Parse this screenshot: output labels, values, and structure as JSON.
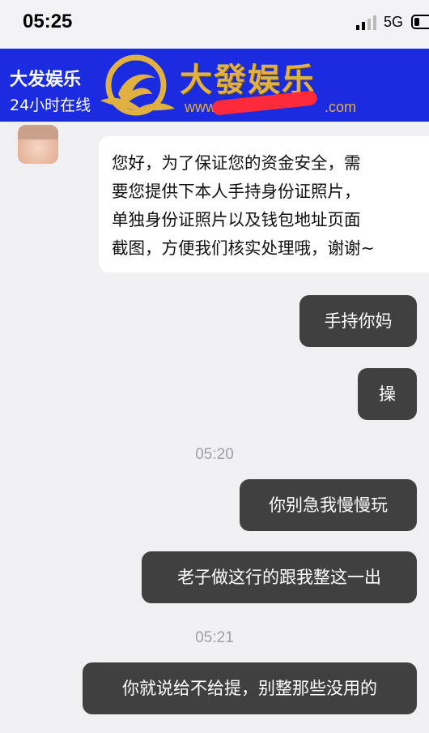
{
  "status_bar": {
    "time": "05:25",
    "network": "5G"
  },
  "header": {
    "contact_name": "大发娱乐",
    "status": "24小时在线",
    "logo_text": "大發娱乐",
    "logo_url_fragment": "www.",
    "logo_url_suffix": ".com"
  },
  "messages": [
    {
      "direction": "incoming",
      "text": "您好，为了保证您的资金安全，需\n要您提供下本人手持身份证照片，\n单独身份证照片以及钱包地址页面\n截图，方便我们核实处理哦，谢谢~"
    },
    {
      "direction": "outgoing",
      "text": "手持你妈"
    },
    {
      "direction": "outgoing",
      "text": "操"
    },
    {
      "type": "timestamp",
      "text": "05:20"
    },
    {
      "direction": "outgoing",
      "text": "你别急我慢慢玩"
    },
    {
      "direction": "outgoing",
      "text": "老子做这行的跟我整这一出"
    },
    {
      "type": "timestamp",
      "text": "05:21"
    },
    {
      "direction": "outgoing",
      "text": "你就说给不给提，别整那些没用的"
    }
  ],
  "colors": {
    "header_bg": "#1a2be0",
    "logo_gold": "#e0b040",
    "outgoing_bubble": "#404040",
    "incoming_bubble": "#ffffff",
    "chat_bg": "#f0f0f3",
    "redaction": "#ff2a3a"
  }
}
